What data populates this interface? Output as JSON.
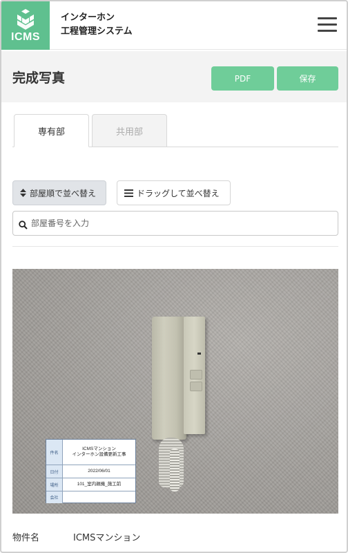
{
  "header": {
    "logo_text": "ICMS",
    "app_title_line1": "インターホン",
    "app_title_line2": "工程管理システム",
    "menu_icon": "hamburger-icon"
  },
  "title_bar": {
    "title": "完成写真",
    "pdf_label": "PDF",
    "save_label": "保存",
    "accent_color": "#6fcd99"
  },
  "tabs": [
    {
      "label": "専有部",
      "active": true
    },
    {
      "label": "共用部",
      "active": false
    }
  ],
  "sort": {
    "room_order_label": "部屋順で並べ替え",
    "room_order_icon": "sort-icon",
    "drag_label": "ドラッグして並べ替え",
    "drag_icon": "drag-handle-icon"
  },
  "search": {
    "placeholder": "部屋番号を入力",
    "value": "",
    "icon": "search-icon"
  },
  "photo": {
    "board": {
      "name_key": "件名",
      "name_value_line1": "ICMSマンション",
      "name_value_line2": "インターホン設備更新工事",
      "date_key": "日付",
      "date_value": "2022/06/01",
      "place_key": "場所",
      "place_value": "101_室内親機_施工前",
      "company_key": "会社",
      "company_value": ""
    }
  },
  "property": {
    "label": "物件名",
    "value": "ICMSマンション"
  }
}
